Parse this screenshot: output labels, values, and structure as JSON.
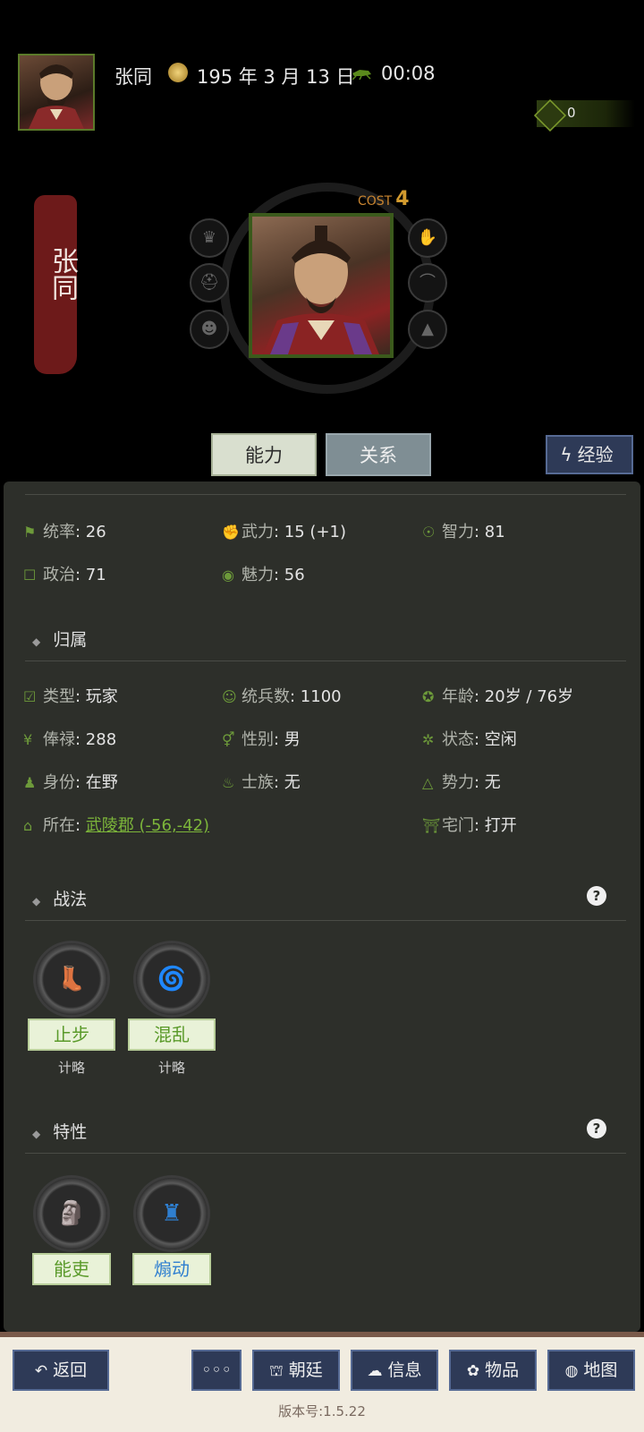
{
  "header": {
    "name": "张同",
    "date": "195 年 3 月 13 日",
    "time": "00:08",
    "resource_value": "0"
  },
  "hero": {
    "banner_name": "张同",
    "cost_label": "COST",
    "cost_value": "4"
  },
  "tabs": {
    "ability": "能力",
    "relation": "关系",
    "experience": "经验"
  },
  "stats": {
    "tongshuai": {
      "label": "统率",
      "value": "26"
    },
    "wuli": {
      "label": "武力",
      "value": "15 (+1)"
    },
    "zhili": {
      "label": "智力",
      "value": "81"
    },
    "zhengzhi": {
      "label": "政治",
      "value": "71"
    },
    "meili": {
      "label": "魅力",
      "value": "56"
    }
  },
  "affiliation": {
    "title": "归属",
    "type": {
      "label": "类型",
      "value": "玩家"
    },
    "troops": {
      "label": "统兵数",
      "value": "1100"
    },
    "age": {
      "label": "年龄",
      "value": "20岁 / 76岁"
    },
    "salary": {
      "label": "俸禄",
      "value": "288"
    },
    "gender": {
      "label": "性别",
      "value": "男"
    },
    "status": {
      "label": "状态",
      "value": "空闲"
    },
    "identity": {
      "label": "身份",
      "value": "在野"
    },
    "clan": {
      "label": "士族",
      "value": "无"
    },
    "faction": {
      "label": "势力",
      "value": "无"
    },
    "location": {
      "label": "所在",
      "value": "武陵郡 (-56,-42)"
    },
    "gate": {
      "label": "宅门",
      "value": "打开"
    }
  },
  "tactics": {
    "title": "战法",
    "items": [
      {
        "name": "止步",
        "type": "计略",
        "icon": "boot-icon",
        "color": "#8a3aa0"
      },
      {
        "name": "混乱",
        "type": "计略",
        "icon": "swirl-icon",
        "color": "#2f8a3a"
      }
    ]
  },
  "traits": {
    "title": "特性",
    "items": [
      {
        "name": "能吏",
        "icon": "moai-icon",
        "color": "#5a9a2a"
      },
      {
        "name": "煽动",
        "icon": "speaker-icon",
        "color": "#2f7fd0"
      }
    ]
  },
  "bottom_nav": {
    "back": "返回",
    "more": "◦◦◦",
    "court": "朝廷",
    "info": "信息",
    "items": "物品",
    "map": "地图"
  },
  "version": "版本号:1.5.22"
}
